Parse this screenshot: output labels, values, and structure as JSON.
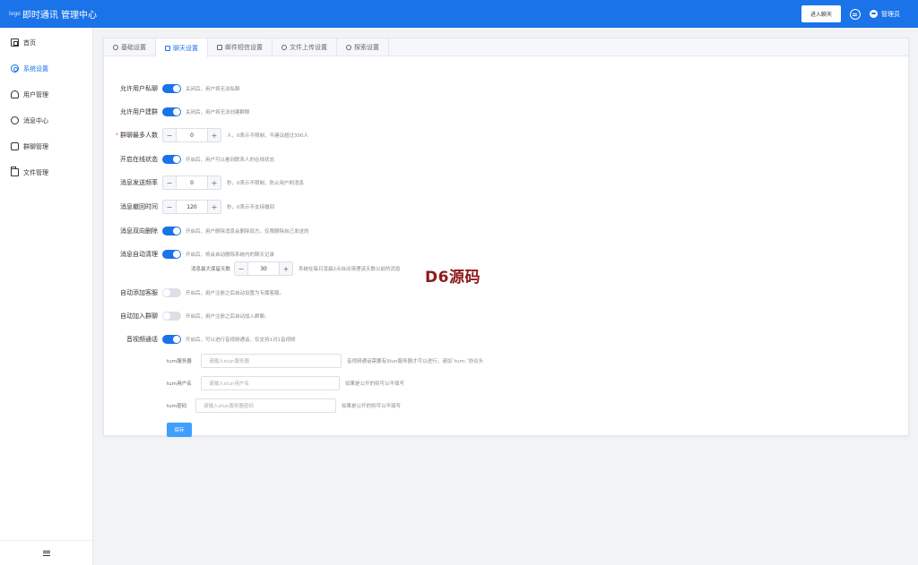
{
  "header": {
    "logo_alt": "logo",
    "title": "即时通讯 管理中心",
    "enter_chat": "进入聊天",
    "admin": "管理员"
  },
  "sidebar": {
    "items": [
      {
        "label": "首页",
        "icon": "home-icon"
      },
      {
        "label": "系统设置",
        "icon": "gear-icon",
        "active": true
      },
      {
        "label": "用户管理",
        "icon": "user-icon"
      },
      {
        "label": "消息中心",
        "icon": "chat-icon"
      },
      {
        "label": "群聊管理",
        "icon": "group-icon"
      },
      {
        "label": "文件管理",
        "icon": "folder-icon"
      }
    ]
  },
  "tabs": [
    {
      "label": "基础设置"
    },
    {
      "label": "聊天设置",
      "active": true
    },
    {
      "label": "邮件短信设置"
    },
    {
      "label": "文件上传设置"
    },
    {
      "label": "探索设置"
    }
  ],
  "form": {
    "allow_private": {
      "label": "允许用户私聊",
      "hint": "关闭后，用户将无法私聊",
      "on": true
    },
    "allow_group": {
      "label": "允许用户建群",
      "hint": "关闭后，用户将无法创建群聊",
      "on": true
    },
    "group_max": {
      "label": "群聊最多人数",
      "value": "0",
      "hint": "人，0表示不限制，不建议超过300人"
    },
    "online_status": {
      "label": "开启在线状态",
      "hint": "开启后，用户可以看到联系人的在线状态",
      "on": true
    },
    "send_rate": {
      "label": "消息发送频率",
      "value": "0",
      "hint": "秒，0表示不限制，防止用户刷消息"
    },
    "recall_time": {
      "label": "消息撤回时间",
      "value": "120",
      "hint": "秒，0表示不支持撤回"
    },
    "two_way_delete": {
      "label": "消息双向删除",
      "hint": "开启后，用户删除消息会删除双方，仅限删除自己发送的",
      "on": true
    },
    "auto_clean": {
      "label": "消息自动清理",
      "hint": "开启后，将会自动删除系统内的聊天记录",
      "on": true
    },
    "keep_days": {
      "label": "消息最大保留天数",
      "value": "30",
      "hint": "系统在每日凌晨2点自动清理该天数以前的消息"
    },
    "auto_add_service": {
      "label": "自动添加客服",
      "hint": "开启后，用户注册之后自动设置为专属客服。",
      "on": false
    },
    "auto_join_group": {
      "label": "自动加入群聊",
      "hint": "开启后，用户注册之后自动加入群聊。",
      "on": false
    },
    "av_call": {
      "label": "音视频通话",
      "hint": "开启后，可以进行音视频通话，仅支持1对1音视频",
      "on": true
    },
    "turn_server": {
      "label": "turn服务器",
      "placeholder": "请输入stun服务器",
      "hint": "音视频通话需要有Stun服务器才可以进行，请加`turn:`协议头"
    },
    "turn_user": {
      "label": "turn用户名",
      "placeholder": "请输入stun用户名",
      "hint": "如果是公开的则可以不填写"
    },
    "turn_pass": {
      "label": "turn密码",
      "placeholder": "请输入stun服务器密码",
      "hint": "如果是公开的则可以不填写"
    },
    "save": "保存"
  },
  "watermark": "D6源码",
  "colors": {
    "primary": "#1a73e8",
    "button": "#409eff",
    "required": "#f56c6c"
  }
}
